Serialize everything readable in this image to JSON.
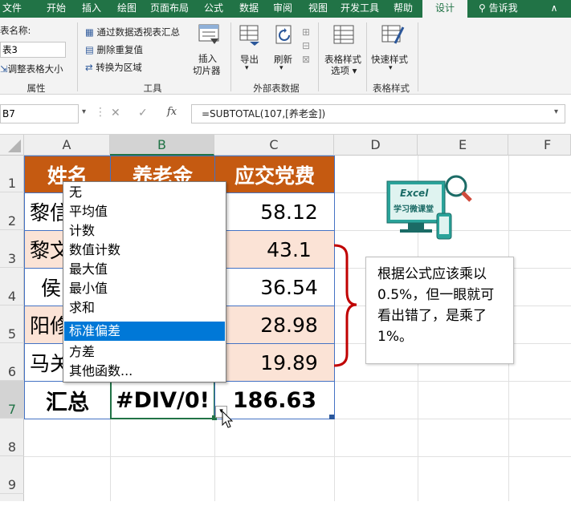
{
  "tabs": [
    "文件",
    "开始",
    "插入",
    "绘图",
    "页面布局",
    "公式",
    "数据",
    "审阅",
    "视图",
    "开发工具",
    "帮助",
    "设计"
  ],
  "active_tab": "设计",
  "tell_me": "告诉我",
  "ribbon": {
    "table_name_label": "表名称:",
    "table_name_value": "表3",
    "resize_table": "调整表格大小",
    "group_properties": "属性",
    "summarize_pivot": "通过数据透视表汇总",
    "remove_duplicates": "删除重复值",
    "convert_to_range": "转换为区域",
    "insert_slicer": "插入\n切片器",
    "insert_slicer_l1": "插入",
    "insert_slicer_l2": "切片器",
    "group_tools": "工具",
    "export": "导出",
    "refresh": "刷新",
    "group_external": "外部表数据",
    "style_options_l1": "表格样式",
    "style_options_l2": "选项",
    "quick_styles": "快速样式",
    "group_styles": "表格样式"
  },
  "formula_bar": {
    "name_box": "B7",
    "fx": "fx",
    "formula": "=SUBTOTAL(107,[养老金])"
  },
  "columns": [
    "A",
    "B",
    "C",
    "D",
    "E",
    "F"
  ],
  "selected_column": "B",
  "rows": [
    "1",
    "2",
    "3",
    "4",
    "5",
    "6",
    "7",
    "8",
    "9"
  ],
  "selected_row": "7",
  "table": {
    "headers": [
      "姓名",
      "养老金",
      "应交党费"
    ],
    "names_partial": [
      "黎信",
      "黎文",
      "侯",
      "阳修",
      "马关"
    ],
    "dues": [
      "58.12",
      "43.1",
      "36.54",
      "28.98",
      "19.89"
    ],
    "total_label": "汇总",
    "total_b": "#DIV/0!",
    "total_c": "186.63"
  },
  "dropdown": {
    "items": [
      "无",
      "平均值",
      "计数",
      "数值计数",
      "最大值",
      "最小值",
      "求和",
      "标准偏差",
      "方差",
      "其他函数..."
    ],
    "highlighted": "标准偏差"
  },
  "logo": {
    "line1": "Excel",
    "line2": "学习微课堂"
  },
  "callout": "根据公式应该乘以0.5%，但一眼就可看出错了，是乘了1%。",
  "colors": {
    "green": "#217346",
    "header_orange": "#c55a11",
    "peach": "#fbe3d6",
    "highlight": "#0078d7",
    "brace": "#c00000"
  }
}
